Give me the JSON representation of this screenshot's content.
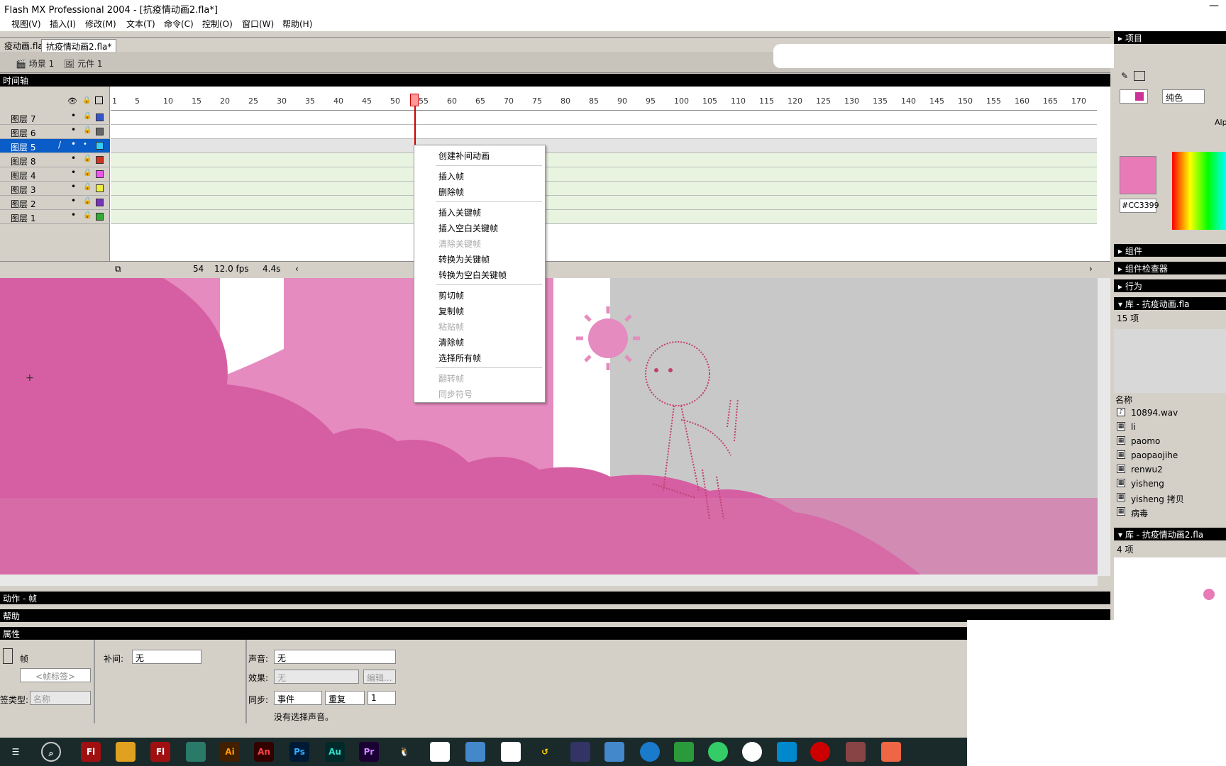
{
  "app_title": "Flash MX Professional 2004 - [抗疫情动画2.fla*]",
  "menus": [
    "视图(V)",
    "插入(I)",
    "修改(M)",
    "文本(T)",
    "命令(C)",
    "控制(O)",
    "窗口(W)",
    "帮助(H)"
  ],
  "doc_tabs": [
    "疫动画.fla",
    "抗疫情动画2.fla*"
  ],
  "scene_crumbs": [
    "场景 1",
    "元件 1"
  ],
  "timeline": {
    "title": "时间轴",
    "ruler": [
      "1",
      "5",
      "10",
      "15",
      "20",
      "25",
      "30",
      "35",
      "40",
      "45",
      "50",
      "55",
      "60",
      "65",
      "70",
      "75",
      "80",
      "85",
      "90",
      "95",
      "100",
      "105",
      "110",
      "115",
      "120",
      "125",
      "130",
      "135",
      "140",
      "145",
      "150",
      "155",
      "160",
      "165",
      "170"
    ],
    "layers": [
      {
        "name": "图层 7",
        "color": "#3355cc"
      },
      {
        "name": "图层 6",
        "color": "#666666"
      },
      {
        "name": "图层 5",
        "color": "#33ccff"
      },
      {
        "name": "图层 8",
        "color": "#cc3322"
      },
      {
        "name": "图层 4",
        "color": "#ee55ee"
      },
      {
        "name": "图层 3",
        "color": "#eeee44"
      },
      {
        "name": "图层 2",
        "color": "#7733bb"
      },
      {
        "name": "图层 1",
        "color": "#33aa33"
      }
    ],
    "current_frame": "54",
    "fps": "12.0 fps",
    "elapsed": "4.4s"
  },
  "context_menu": {
    "items": [
      {
        "label": "创建补间动画",
        "disabled": false
      },
      {
        "label": "插入帧",
        "disabled": false
      },
      {
        "label": "删除帧",
        "disabled": false
      },
      {
        "label": "插入关键帧",
        "disabled": false
      },
      {
        "label": "插入空白关键帧",
        "disabled": false
      },
      {
        "label": "清除关键帧",
        "disabled": true
      },
      {
        "label": "转换为关键帧",
        "disabled": false
      },
      {
        "label": "转换为空白关键帧",
        "disabled": false
      },
      {
        "label": "剪切帧",
        "disabled": false
      },
      {
        "label": "复制帧",
        "disabled": false
      },
      {
        "label": "粘贴帧",
        "disabled": true
      },
      {
        "label": "清除帧",
        "disabled": false
      },
      {
        "label": "选择所有帧",
        "disabled": false
      },
      {
        "label": "翻转帧",
        "disabled": true
      },
      {
        "label": "同步符号",
        "disabled": true
      }
    ]
  },
  "panels": {
    "actions": "动作 - 帧",
    "help": "帮助",
    "properties": "属性"
  },
  "properties": {
    "frame_label": "帧",
    "frame_label_placeholder": "<帧标签>",
    "label_type_label": "签类型:",
    "label_type_value": "名称",
    "tween_label": "补间:",
    "tween_value": "无",
    "sound_label": "声音:",
    "sound_value": "无",
    "effect_label": "效果:",
    "effect_value": "无",
    "edit_button": "编辑...",
    "sync_label": "同步:",
    "sync_value": "事件",
    "repeat_value": "重复",
    "repeat_count": "1",
    "no_sound": "没有选择声音。"
  },
  "right_panel": {
    "project": "项目",
    "fill_type": "纯色",
    "alpha_label": "Alp",
    "color_hex": "#CC3399",
    "components": "组件",
    "component_inspector": "组件检查器",
    "behaviors": "行为",
    "library1_title": "库 - 抗疫动画.fla",
    "library1_count": "15 项",
    "name_col": "名称",
    "library1_items": [
      "10894.wav",
      "li",
      "paomo",
      "paopaojihe",
      "renwu2",
      "yisheng",
      "yisheng 拷贝",
      "病毒"
    ],
    "library2_title": "库 - 抗疫情动画2.fla",
    "library2_count": "4 项"
  },
  "taskbar": [
    "Fl",
    "Fl",
    "Ai",
    "An",
    "Ps",
    "Au",
    "Pr"
  ],
  "colors": {
    "stage_pink": "#d65fa3",
    "stage_light_pink": "#e58bbf",
    "stage_gray": "#c8c8c8",
    "selection_blue": "#0a5cc8"
  }
}
